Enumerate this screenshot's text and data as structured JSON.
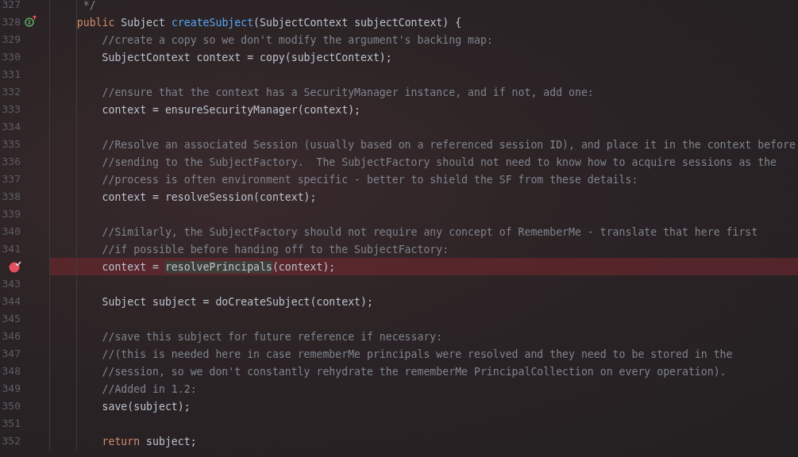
{
  "editor": {
    "lines": [
      {
        "number": "327",
        "breakpoint": false,
        "segments": [
          {
            "kind": "comment",
            "text": "     */"
          }
        ]
      },
      {
        "number": "328",
        "gutter_icon": {
          "kind": "implements"
        },
        "breakpoint": false,
        "segments": [
          {
            "kind": "keyword",
            "text": "    public "
          },
          {
            "kind": "plain",
            "text": "Subject "
          },
          {
            "kind": "method",
            "text": "createSubject"
          },
          {
            "kind": "plain",
            "text": "(SubjectContext subjectContext) {"
          }
        ]
      },
      {
        "number": "329",
        "breakpoint": false,
        "segments": [
          {
            "kind": "comment",
            "text": "        //create a copy so we don't modify the argument's backing map:"
          }
        ]
      },
      {
        "number": "330",
        "breakpoint": false,
        "segments": [
          {
            "kind": "plain",
            "text": "        SubjectContext context = copy(subjectContext);"
          }
        ]
      },
      {
        "number": "331",
        "breakpoint": false
      },
      {
        "number": "332",
        "breakpoint": false,
        "segments": [
          {
            "kind": "comment",
            "text": "        //ensure that the context has a SecurityManager instance, and if not, add one:"
          }
        ]
      },
      {
        "number": "333",
        "breakpoint": false,
        "segments": [
          {
            "kind": "plain",
            "text": "        context = ensureSecurityManager(context);"
          }
        ]
      },
      {
        "number": "334",
        "breakpoint": false
      },
      {
        "number": "335",
        "breakpoint": false,
        "segments": [
          {
            "kind": "comment",
            "text": "        //Resolve an associated Session (usually based on a referenced session ID), and place it in the context before"
          }
        ]
      },
      {
        "number": "336",
        "breakpoint": false,
        "segments": [
          {
            "kind": "comment",
            "text": "        //sending to the SubjectFactory.  The SubjectFactory should not need to know how to acquire sessions as the"
          }
        ]
      },
      {
        "number": "337",
        "breakpoint": false,
        "segments": [
          {
            "kind": "comment",
            "text": "        //process is often environment specific - better to shield the SF from these details:"
          }
        ]
      },
      {
        "number": "338",
        "breakpoint": false,
        "segments": [
          {
            "kind": "plain",
            "text": "        context = resolveSession(context);"
          }
        ]
      },
      {
        "number": "339",
        "breakpoint": false
      },
      {
        "number": "340",
        "breakpoint": false,
        "segments": [
          {
            "kind": "comment",
            "text": "        //Similarly, the SubjectFactory should not require any concept of RememberMe - translate that here first"
          }
        ]
      },
      {
        "number": "341",
        "breakpoint": false,
        "segments": [
          {
            "kind": "comment",
            "text": "        //if possible before handing off to the SubjectFactory:"
          }
        ]
      },
      {
        "breakpoint": true,
        "segments": [
          {
            "kind": "plain",
            "text": "        context = "
          },
          {
            "kind": "usage",
            "text": "resolvePrincipals"
          },
          {
            "kind": "plain",
            "text": "(context);"
          }
        ]
      },
      {
        "number": "343",
        "breakpoint": false
      },
      {
        "number": "344",
        "breakpoint": false,
        "segments": [
          {
            "kind": "plain",
            "text": "        Subject subject = doCreateSubject(context);"
          }
        ]
      },
      {
        "number": "345",
        "breakpoint": false
      },
      {
        "number": "346",
        "breakpoint": false,
        "segments": [
          {
            "kind": "comment",
            "text": "        //save this subject for future reference if necessary:"
          }
        ]
      },
      {
        "number": "347",
        "breakpoint": false,
        "segments": [
          {
            "kind": "comment",
            "text": "        //(this is needed here in case rememberMe principals were resolved and they need to be stored in the"
          }
        ]
      },
      {
        "number": "348",
        "breakpoint": false,
        "segments": [
          {
            "kind": "comment",
            "text": "        //session, so we don't constantly rehydrate the rememberMe PrincipalCollection on every operation)."
          }
        ]
      },
      {
        "number": "349",
        "breakpoint": false,
        "segments": [
          {
            "kind": "comment",
            "text": "        //Added in 1.2:"
          }
        ]
      },
      {
        "number": "350",
        "breakpoint": false,
        "segments": [
          {
            "kind": "plain",
            "text": "        save(subject);"
          }
        ]
      },
      {
        "number": "351",
        "breakpoint": false
      },
      {
        "number": "352",
        "breakpoint": false,
        "segments": [
          {
            "kind": "keyword",
            "text": "        return "
          },
          {
            "kind": "plain",
            "text": "subject;"
          }
        ]
      }
    ]
  }
}
